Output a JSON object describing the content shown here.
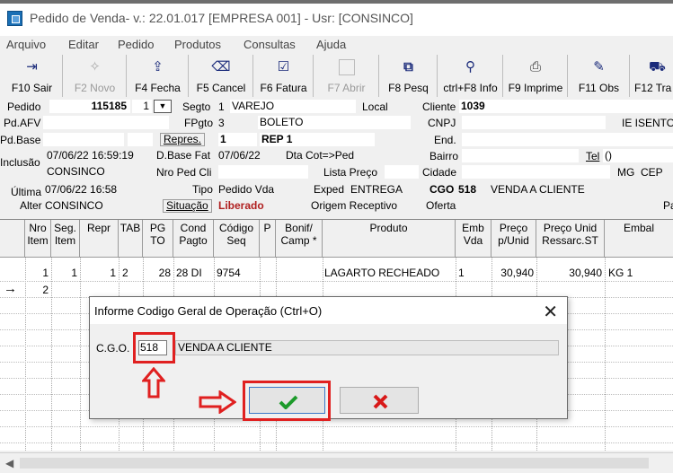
{
  "window": {
    "title": "Pedido de Venda- v.: 22.01.017  [EMPRESA 001] - Usr: [CONSINCO]"
  },
  "menu": [
    "Arquivo",
    "Editar",
    "Pedido",
    "Produtos",
    "Consultas",
    "Ajuda"
  ],
  "toolbar": [
    {
      "label": "F10 Sair",
      "icon": "exit-icon",
      "glyph": "⇥",
      "enabled": true
    },
    {
      "label": "F2 Novo",
      "icon": "new-icon",
      "glyph": "✧",
      "enabled": false
    },
    {
      "label": "F4 Fecha",
      "icon": "close-order-icon",
      "glyph": "⇪",
      "enabled": true
    },
    {
      "label": "F5 Cancel",
      "icon": "cancel-icon",
      "glyph": "⌫",
      "enabled": true
    },
    {
      "label": "F6 Fatura",
      "icon": "invoice-icon",
      "glyph": "☑",
      "enabled": true
    },
    {
      "label": "F7 Abrir",
      "icon": "open-icon",
      "glyph": "",
      "enabled": false
    },
    {
      "label": "F8 Pesq",
      "icon": "binoculars-icon",
      "glyph": "⧉",
      "enabled": true
    },
    {
      "label": "ctrl+F8 Info",
      "icon": "info-icon",
      "glyph": "⚲",
      "enabled": true
    },
    {
      "label": "F9 Imprime",
      "icon": "printer-icon",
      "glyph": "⎙",
      "enabled": true
    },
    {
      "label": "F11 Obs",
      "icon": "notes-icon",
      "glyph": "✎",
      "enabled": true
    },
    {
      "label": "F12 Tra",
      "icon": "truck-icon",
      "glyph": "⛟",
      "enabled": true
    }
  ],
  "form": {
    "pedido_label": "Pedido",
    "pedido_value": "115185",
    "pedido_seq": "1",
    "segto_label": "Segto",
    "segto_value": "1",
    "segto_name": "VAREJO",
    "segto_local": "Local",
    "cliente_label": "Cliente",
    "cliente_value": "1039",
    "pdafv_label": "Pd.AFV",
    "fpgto_label": "FPgto",
    "fpgto_value": "3",
    "fpgto_name": "BOLETO",
    "cnpj_label": "CNPJ",
    "ie_label": "IE ISENTO",
    "pdbase_label": "Pd.Base",
    "repres_button": "Repres.",
    "repres_value": "1",
    "repres_name": "REP 1",
    "end_label": "End.",
    "inclusao_label": "Inclusão",
    "inclusao_date": "07/06/22 16:59:19",
    "inclusao_user": "CONSINCO",
    "dbasefat_label": "D.Base Fat",
    "dbasefat_value": "07/06/22",
    "dtacot_label": "Dta Cot=>Ped",
    "bairro_label": "Bairro",
    "tel_label": "Tel",
    "tel_value": "()",
    "nroped_label": "Nro Ped Cli",
    "listapreco_label": "Lista Preço",
    "cidade_label": "Cidade",
    "uf_value": "MG",
    "cep_label": "CEP",
    "ultima_label": "Última",
    "ultima_value": "07/06/22 16:58",
    "tipo_label": "Tipo",
    "tipo_value": "Pedido Vda",
    "exped_label": "Exped",
    "exped_value": "ENTREGA",
    "cgo_label": "CGO",
    "cgo_value": "518",
    "cgo_name": "VENDA A CLIENTE",
    "alter_label": "Alter",
    "alter_value": "CONSINCO",
    "situacao_button": "Situação",
    "situacao_value": "Liberado",
    "origem_label": "Origem Receptivo",
    "oferta_label": "Oferta",
    "pa_label": "Pa"
  },
  "grid": {
    "headers": [
      "Nro Item",
      "Seg. Item",
      "Repr",
      "TAB",
      "PG TO",
      "Cond Pagto",
      "Código Seq",
      "P",
      "Bonif/ Camp *",
      "Produto",
      "Emb Vda",
      "Preço p/Unid",
      "Preço Unid Ressarc.ST",
      "Embal"
    ],
    "rows": [
      [
        "1",
        "1",
        "1",
        "2",
        "28",
        "28 DI",
        "9754",
        "",
        "",
        "LAGARTO RECHEADO",
        "1",
        "30,940",
        "30,940",
        "KG 1"
      ],
      [
        "2",
        "",
        "",
        "",
        "",
        "",
        "",
        "",
        "",
        "",
        "",
        "",
        "",
        ""
      ]
    ]
  },
  "dialog": {
    "title": "Informe Codigo Geral de Operação    (Ctrl+O)",
    "cgo_label": "C.G.O.",
    "cgo_value": "518",
    "cgo_desc": "VENDA A CLIENTE",
    "ok_icon": "check-icon",
    "cancel_icon": "x-icon"
  },
  "colors": {
    "highlight": "#e02020",
    "ok_green": "#1c9a2a",
    "cancel_red": "#d81818",
    "liberado": "#b02020"
  }
}
